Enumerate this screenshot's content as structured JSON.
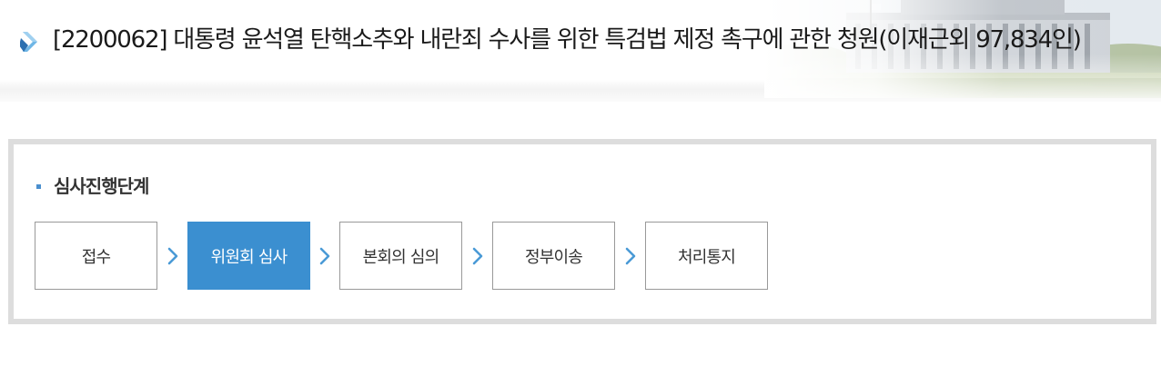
{
  "page": {
    "title": "[2200062] 대통령 윤석열 탄핵소추와 내란죄 수사를 위한 특검법 제정 촉구에 관한 청원(이재근외 97,834인)",
    "title_icon": "blue-diamond-arrow-icon"
  },
  "process": {
    "section_title": "심사진행단계",
    "steps": [
      {
        "label": "접수",
        "active": false
      },
      {
        "label": "위원회 심사",
        "active": true
      },
      {
        "label": "본회의 심의",
        "active": false
      },
      {
        "label": "정부이송",
        "active": false
      },
      {
        "label": "처리통지",
        "active": false
      }
    ],
    "separator_icon": "chevron-right-icon"
  },
  "colors": {
    "accent": "#3b8fd0",
    "chevron": "#4a9ad6",
    "box_border": "#dddddd",
    "step_border": "#999999"
  }
}
